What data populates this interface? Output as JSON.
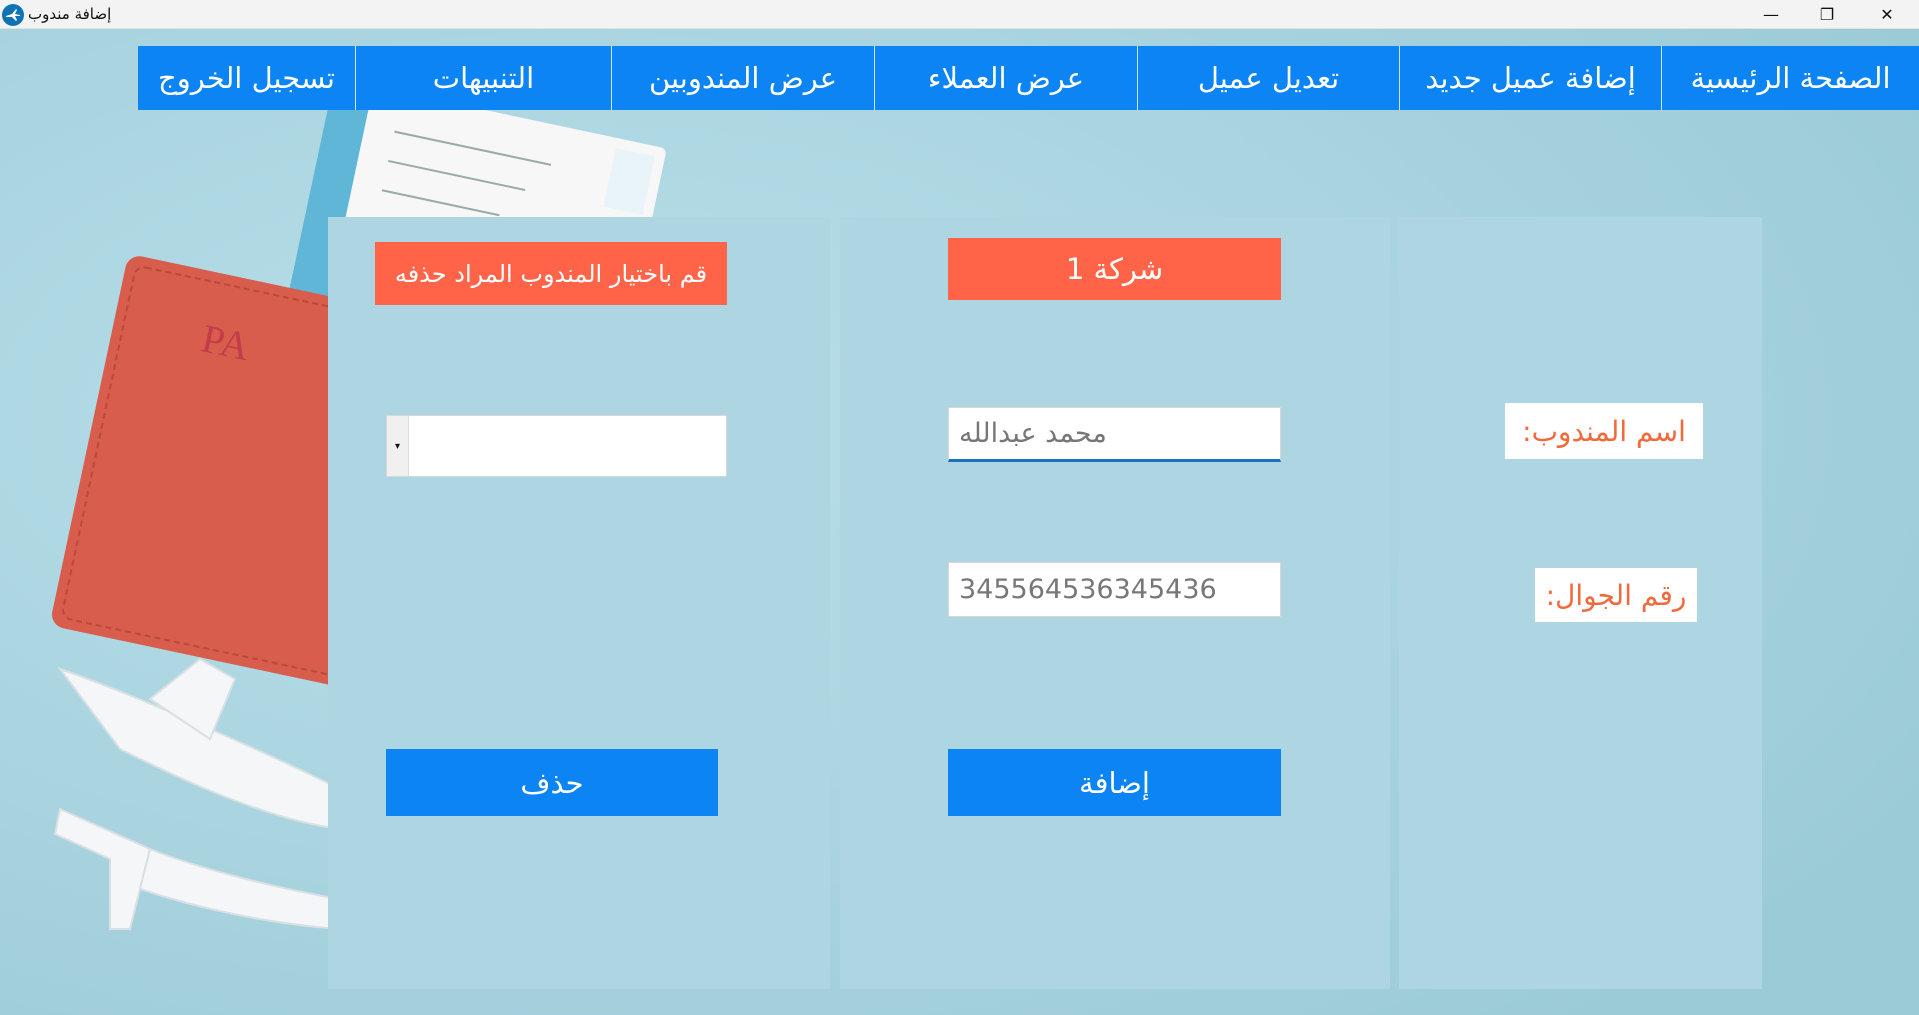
{
  "window": {
    "title": "إضافة مندوب",
    "controls": {
      "minimize": "—",
      "maximize": "❐",
      "close": "✕"
    }
  },
  "nav": {
    "items": [
      "الصفحة الرئيسية",
      "إضافة عميل جديد",
      "تعديل عميل",
      "عرض العملاء",
      "عرض المندوبين",
      "التنبيهات",
      "تسجيل الخروج"
    ]
  },
  "add_form": {
    "company": "شركة 1",
    "name_label": "اسم المندوب:",
    "name_value": "محمد عبدالله",
    "phone_label": "رقم الجوال:",
    "phone_value": "345564536345436",
    "add_button": "إضافة"
  },
  "delete_form": {
    "instruction": "قم باختيار المندوب المراد حذفه",
    "selected": "",
    "delete_button": "حذف"
  },
  "colors": {
    "nav_bg": "#0c84f4",
    "accent_red": "#ff6449",
    "label_text": "#f06a3c",
    "panel_bg": "#add6e2"
  }
}
